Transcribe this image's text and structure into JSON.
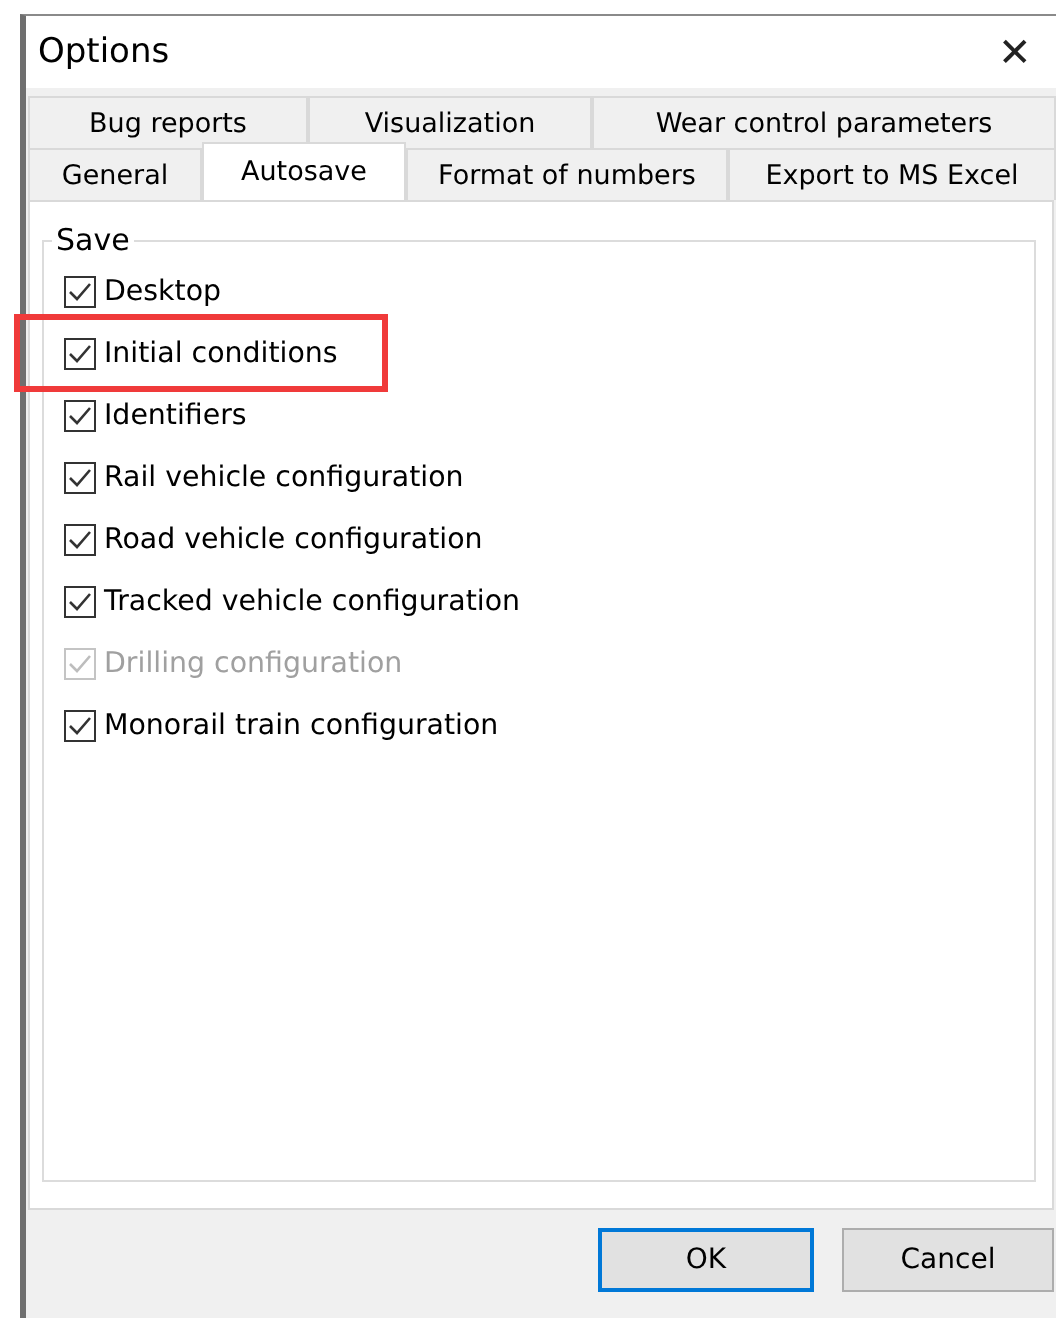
{
  "window": {
    "title": "Options",
    "close": "✕"
  },
  "tab_rows": [
    [
      {
        "label": "Bug reports",
        "selected": false
      },
      {
        "label": "Visualization",
        "selected": false
      },
      {
        "label": "Wear control parameters",
        "selected": false
      }
    ],
    [
      {
        "label": "General",
        "selected": false
      },
      {
        "label": "Autosave",
        "selected": true
      },
      {
        "label": "Format of numbers",
        "selected": false
      },
      {
        "label": "Export to MS Excel",
        "selected": false
      }
    ]
  ],
  "group": {
    "title": "Save",
    "items": [
      {
        "label": "Desktop",
        "checked": true,
        "disabled": false,
        "highlighted": false
      },
      {
        "label": "Initial conditions",
        "checked": true,
        "disabled": false,
        "highlighted": true
      },
      {
        "label": "Identifiers",
        "checked": true,
        "disabled": false,
        "highlighted": false
      },
      {
        "label": "Rail vehicle configuration",
        "checked": true,
        "disabled": false,
        "highlighted": false
      },
      {
        "label": "Road vehicle configuration",
        "checked": true,
        "disabled": false,
        "highlighted": false
      },
      {
        "label": "Tracked vehicle configuration",
        "checked": true,
        "disabled": false,
        "highlighted": false
      },
      {
        "label": "Drilling configuration",
        "checked": true,
        "disabled": true,
        "highlighted": false
      },
      {
        "label": "Monorail train configuration",
        "checked": true,
        "disabled": false,
        "highlighted": false
      }
    ]
  },
  "buttons": [
    {
      "label": "OK",
      "default": true
    },
    {
      "label": "Cancel",
      "default": false
    }
  ]
}
